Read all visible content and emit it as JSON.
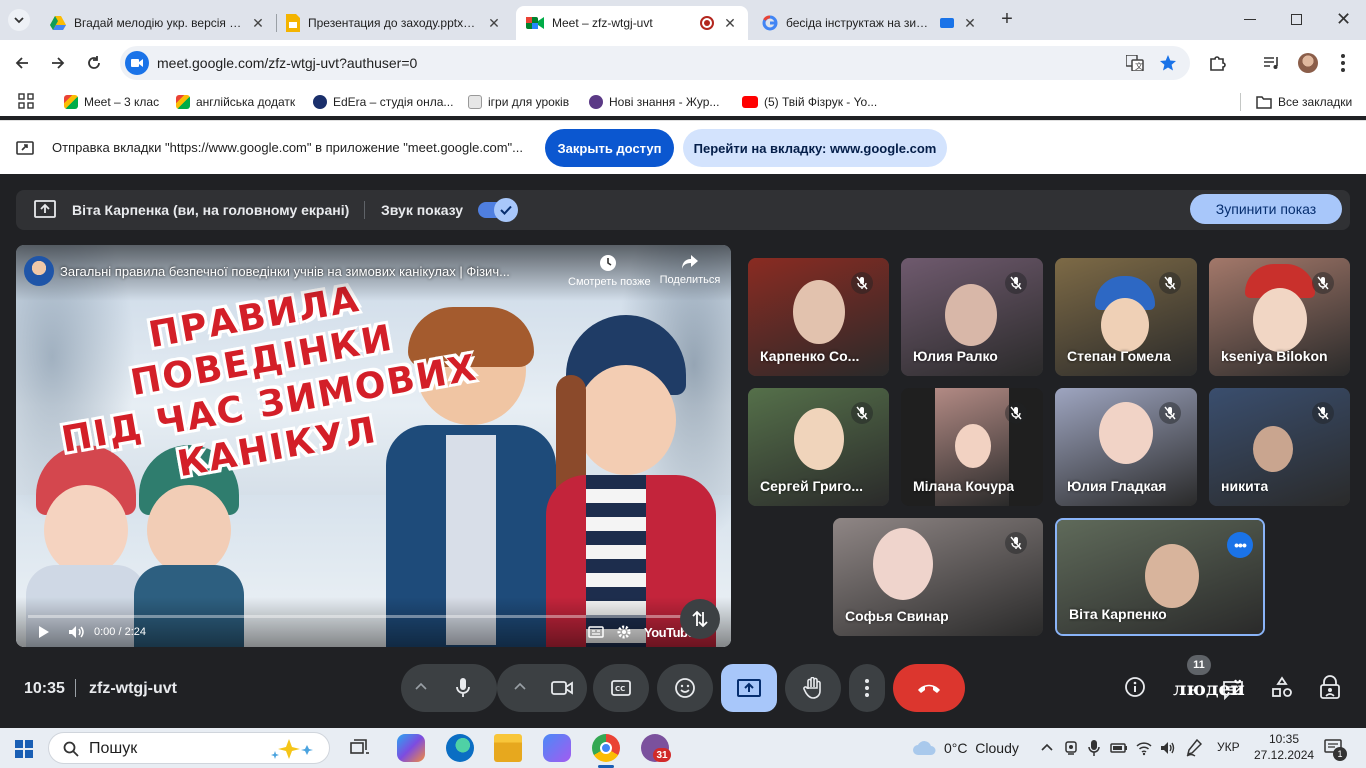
{
  "tabs": [
    {
      "title": "Вгадай мелодію укр. версія – Gem",
      "favicon": "google-drive-icon",
      "active": false
    },
    {
      "title": "Презентация до заходу.pptx - Google",
      "favicon": "google-slides-icon",
      "active": false
    },
    {
      "title": "Meet – zfz-wtgj-uvt",
      "favicon": "google-meet-icon",
      "active": true
    },
    {
      "title": "бесіда інструктаж на зимові",
      "favicon": "google-icon",
      "active": false
    }
  ],
  "address_bar": {
    "url": "meet.google.com/zfz-wtgj-uvt?authuser=0"
  },
  "bookmarks": [
    {
      "label": "Meet – 3 клас",
      "icon": "google-meet-icon"
    },
    {
      "label": "англійська додатк",
      "icon": "google-meet-icon"
    },
    {
      "label": "EdEra – студія онла...",
      "icon": "edera-icon"
    },
    {
      "label": "ігри для уроків",
      "icon": "bookmark-icon"
    },
    {
      "label": "Нові знання - Жур...",
      "icon": "book-icon"
    },
    {
      "label": "(5) Твій Фізрук - Yo...",
      "icon": "youtube-icon"
    }
  ],
  "all_bookmarks_label": "Все закладки",
  "infobar": {
    "text": "Отправка вкладки \"https://www.google.com\" в приложение \"meet.google.com\"...",
    "stop_sharing": "Закрыть доступ",
    "go_to_tab": "Перейти на вкладку: www.google.com"
  },
  "presenting_bar": {
    "presenter": "Віта Карпенка (ви, на головному екрані)",
    "sound_label": "Звук показу",
    "sound_on": true,
    "stop_button": "Зупинити показ"
  },
  "video": {
    "title": "Загальні правила безпечної поведінки учнів на зимових канікулах | Фізич...",
    "watch_later": "Смотреть позже",
    "share": "Поделиться",
    "headline_lines": [
      "ПРАВИЛА ПОВЕДІНКИ",
      "ПІД ЧАС ЗИМОВИХ",
      "КАНІКУЛ"
    ],
    "time": "0:00 / 2:24",
    "brand": "YouTube"
  },
  "participants": [
    {
      "name": "Карпенко Со...",
      "muted": true,
      "color": "#8a2b22"
    },
    {
      "name": "Юлия Ралко",
      "muted": true,
      "color": "#6f5a6e"
    },
    {
      "name": "Степан Гомела",
      "muted": true,
      "color": "#7d6a46"
    },
    {
      "name": "kseniya Bilokon",
      "muted": true,
      "color": "#a3786a"
    },
    {
      "name": "Сергей Григо...",
      "muted": true,
      "color": "#55704a"
    },
    {
      "name": "Мілана Кочура",
      "muted": true,
      "color": "#b28a84"
    },
    {
      "name": "Юлия Гладкая",
      "muted": true,
      "color": "#9ea5c0"
    },
    {
      "name": "никита",
      "muted": true,
      "color": "#3a4e6e"
    },
    {
      "name": "Софья Свинар",
      "muted": true,
      "color": "#8f8685"
    },
    {
      "name": "Віта Карпенко",
      "muted": false,
      "color": "#5f6a5a"
    }
  ],
  "meeting": {
    "time": "10:35",
    "code": "zfz-wtgj-uvt",
    "people_count": "11",
    "people_label": "людей"
  },
  "taskbar": {
    "search_placeholder": "Пошук",
    "weather": "0°C  Cloudy",
    "language": "УКР",
    "clock_time": "10:35",
    "clock_date": "27.12.2024",
    "calendar_badge": "31",
    "notification_count": "1"
  }
}
